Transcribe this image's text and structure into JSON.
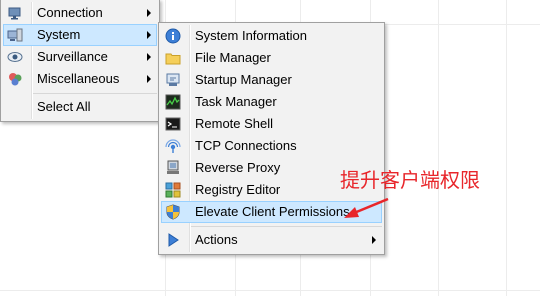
{
  "menu_main": {
    "items": [
      {
        "label": "Connection",
        "icon": "connection-icon",
        "has_submenu": true
      },
      {
        "label": "System",
        "icon": "system-computer-icon",
        "has_submenu": true,
        "highlighted": true
      },
      {
        "label": "Surveillance",
        "icon": "eye-icon",
        "has_submenu": true
      },
      {
        "label": "Miscellaneous",
        "icon": "misc-icon",
        "has_submenu": true
      },
      {
        "label": "Select All",
        "icon": "",
        "has_submenu": false
      }
    ]
  },
  "menu_system": {
    "items": [
      {
        "label": "System Information",
        "icon": "info-icon"
      },
      {
        "label": "File Manager",
        "icon": "folder-icon"
      },
      {
        "label": "Startup Manager",
        "icon": "startup-icon"
      },
      {
        "label": "Task Manager",
        "icon": "task-manager-icon"
      },
      {
        "label": "Remote Shell",
        "icon": "terminal-icon"
      },
      {
        "label": "TCP Connections",
        "icon": "network-icon"
      },
      {
        "label": "Reverse Proxy",
        "icon": "proxy-icon"
      },
      {
        "label": "Registry Editor",
        "icon": "registry-icon"
      },
      {
        "label": "Elevate Client Permissions",
        "icon": "uac-shield-icon",
        "highlighted": true
      },
      {
        "label": "Actions",
        "icon": "play-icon",
        "has_submenu": true
      }
    ]
  },
  "annotation": {
    "text": "提升客户端权限",
    "color": "#e8262b"
  },
  "colors": {
    "highlight_bg": "#cde8ff",
    "highlight_border": "#99d1ff",
    "menu_bg": "#f2f2f2"
  }
}
